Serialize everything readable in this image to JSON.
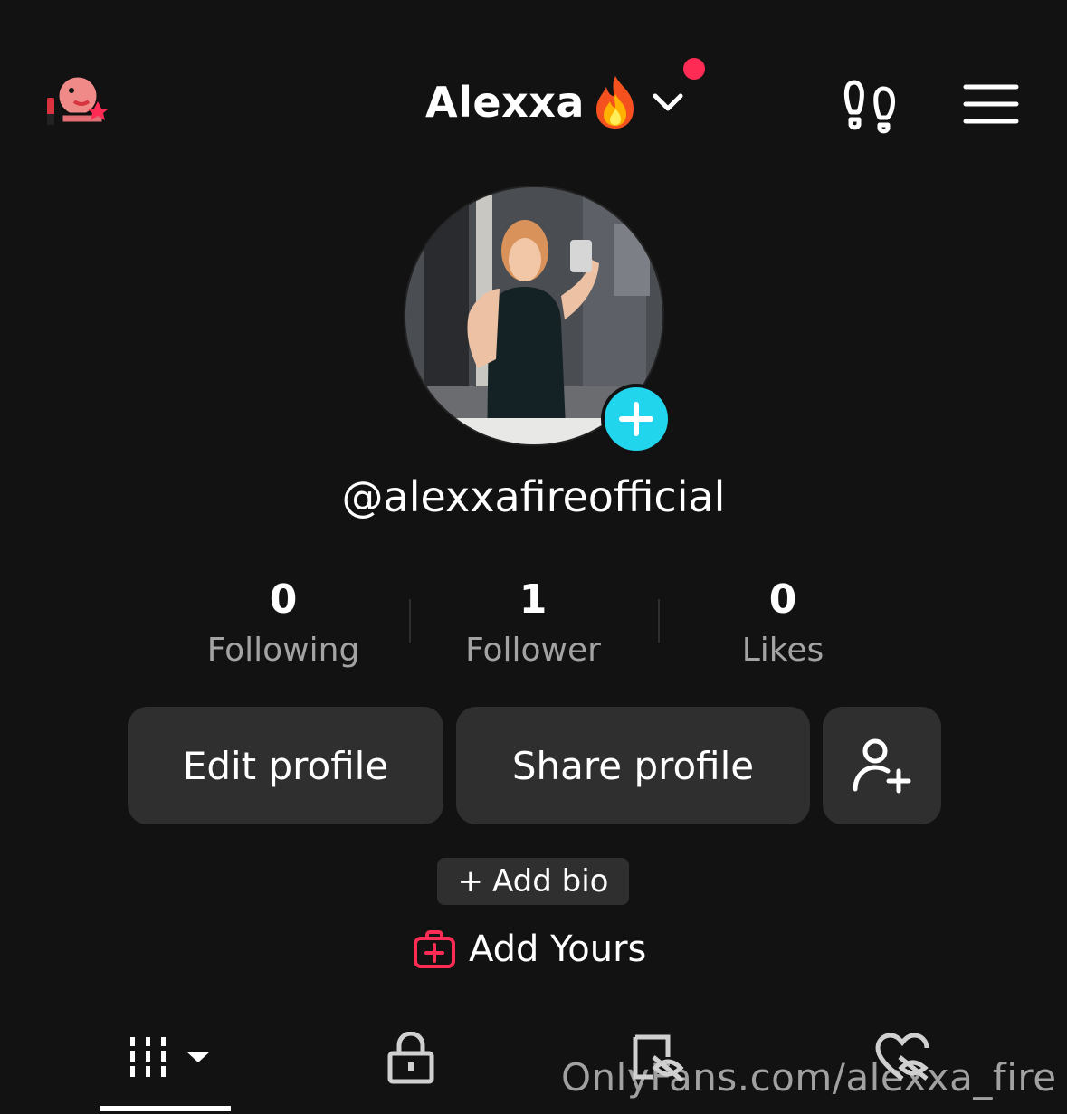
{
  "header": {
    "title": "Alexxa",
    "title_emoji": "fire-emoji",
    "notification_dot_color": "#fe2c55"
  },
  "profile": {
    "handle": "@alexxafireofficial",
    "avatar_badge_color": "#20d5ec"
  },
  "stats": [
    {
      "value": "0",
      "label": "Following"
    },
    {
      "value": "1",
      "label": "Follower"
    },
    {
      "value": "0",
      "label": "Likes"
    }
  ],
  "actions": {
    "edit_profile": "Edit profile",
    "share_profile": "Share profile",
    "add_bio": "Add bio",
    "add_yours": "Add Yours"
  },
  "tabs": [
    {
      "name": "posts-grid",
      "active": true
    },
    {
      "name": "private",
      "active": false
    },
    {
      "name": "hidden",
      "active": false
    },
    {
      "name": "liked",
      "active": false
    }
  ],
  "watermark": "OnlyFans.com/alexxa_fire",
  "colors": {
    "background": "#121212",
    "button": "#2f2f2f",
    "accent_red": "#fe2c55",
    "accent_cyan": "#20d5ec",
    "muted_text": "#a3a3a3"
  }
}
